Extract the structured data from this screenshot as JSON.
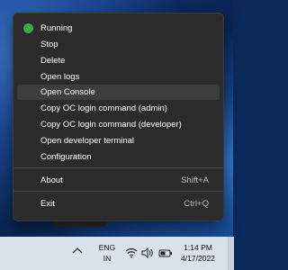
{
  "menu": {
    "items": [
      {
        "label": "Running",
        "shortcut": "",
        "status": true
      },
      {
        "label": "Stop",
        "shortcut": ""
      },
      {
        "label": "Delete",
        "shortcut": ""
      },
      {
        "label": "Open logs",
        "shortcut": ""
      },
      {
        "label": "Open Console",
        "shortcut": "",
        "hovered": true
      },
      {
        "label": "Copy OC login command (admin)",
        "shortcut": ""
      },
      {
        "label": "Copy OC login command (developer)",
        "shortcut": ""
      },
      {
        "label": "Open developer terminal",
        "shortcut": ""
      },
      {
        "label": "Configuration",
        "shortcut": ""
      },
      {
        "label": "About",
        "shortcut": "Shift+A"
      },
      {
        "label": "Exit",
        "shortcut": "Ctrl+Q"
      }
    ],
    "status_color": "#3fa83f"
  },
  "taskbar": {
    "language_line1": "ENG",
    "language_line2": "IN",
    "time": "1:14 PM",
    "date": "4/17/2022",
    "icons": [
      "chevron-up-icon",
      "wifi-icon",
      "volume-icon",
      "battery-icon"
    ]
  }
}
